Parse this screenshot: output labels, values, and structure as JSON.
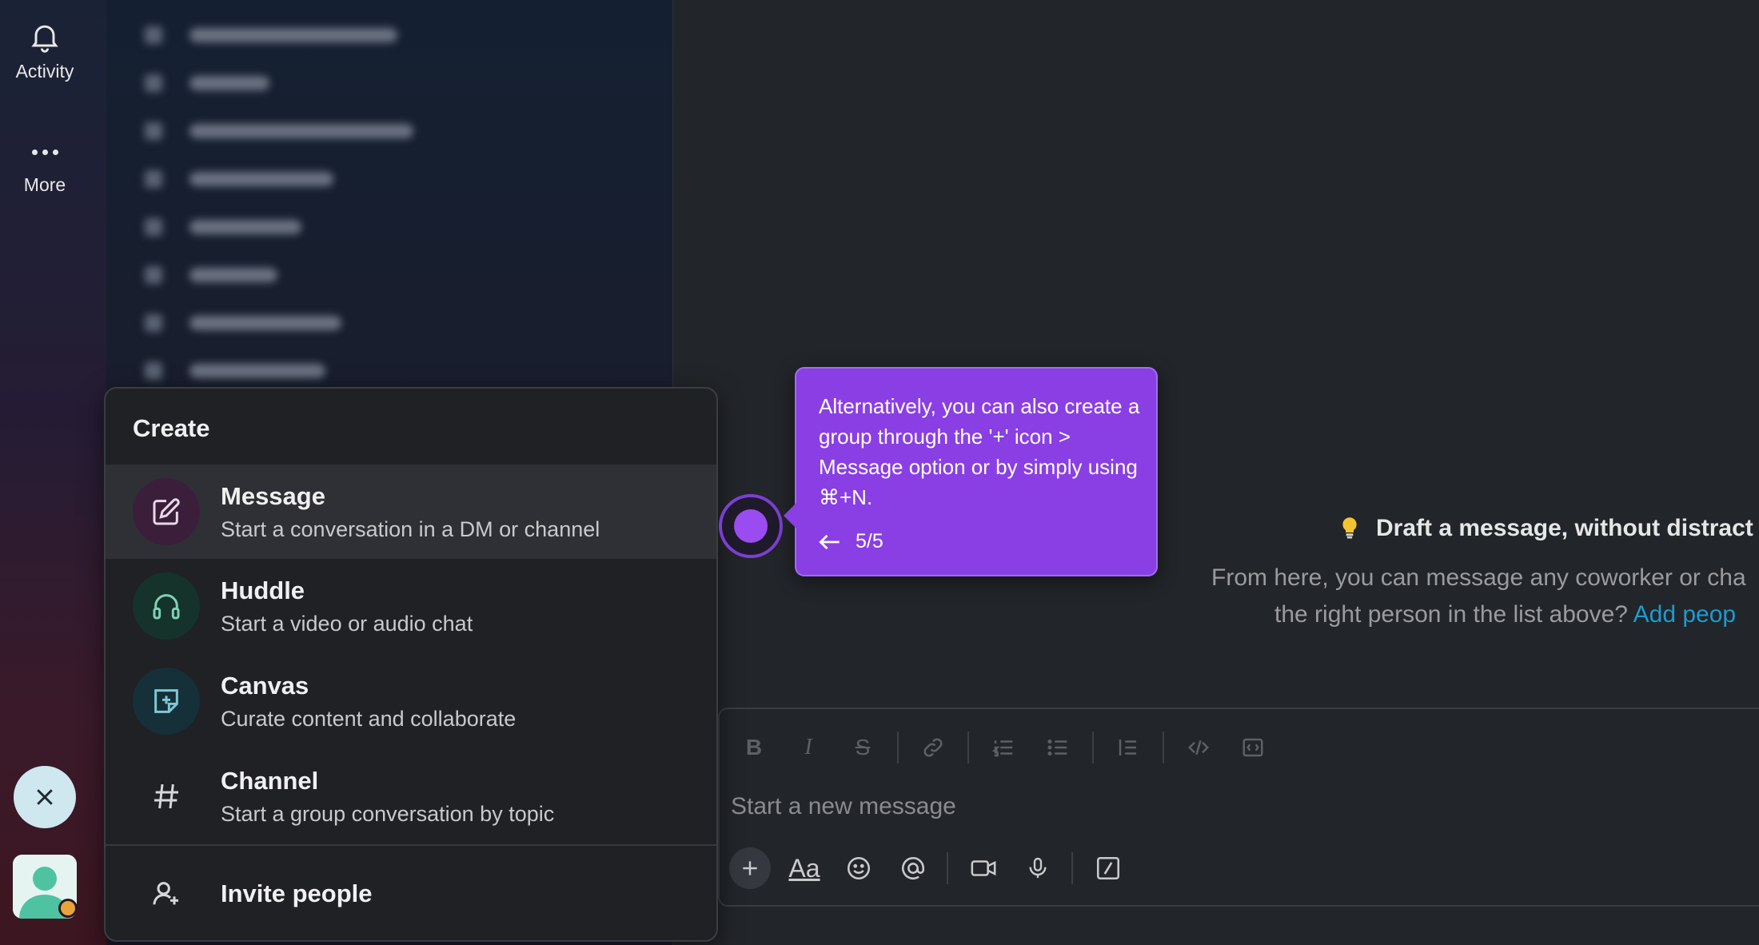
{
  "rail": {
    "activity_label": "Activity",
    "more_label": "More"
  },
  "create_menu": {
    "title": "Create",
    "items": [
      {
        "title": "Message",
        "subtitle": "Start a conversation in a DM or channel",
        "icon": "compose-icon",
        "color": "#3b1f3a"
      },
      {
        "title": "Huddle",
        "subtitle": "Start a video or audio chat",
        "icon": "headphones-icon",
        "color": "#15332b"
      },
      {
        "title": "Canvas",
        "subtitle": "Curate content and collaborate",
        "icon": "canvas-icon",
        "color": "#153038"
      },
      {
        "title": "Channel",
        "subtitle": "Start a group conversation by topic",
        "icon": "hash-icon",
        "color": "#1f2125"
      }
    ],
    "invite_label": "Invite people"
  },
  "tooltip": {
    "text": "Alternatively, you can also create a group through the '+' icon > Message option or by simply using ⌘+N.",
    "step": "5/5",
    "color": "#8a3fe4"
  },
  "draft": {
    "title": "Draft a message, without distract",
    "line1": "From here, you can message any coworker or cha",
    "line2": "the right person in the list above?",
    "link": "Add peop"
  },
  "composer": {
    "placeholder": "Start a new message"
  }
}
